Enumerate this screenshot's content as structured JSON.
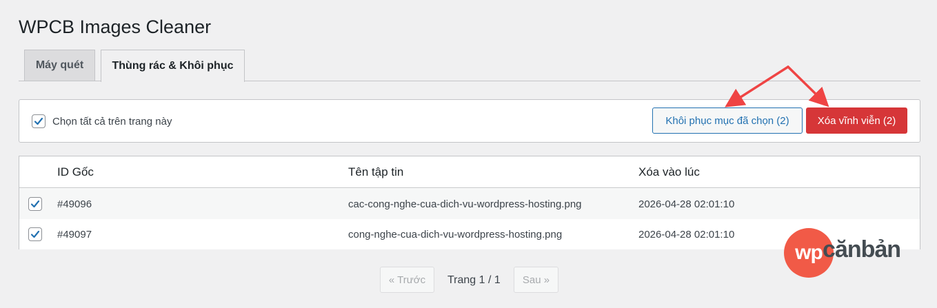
{
  "page": {
    "title": "WPCB Images Cleaner"
  },
  "tabs": [
    {
      "label": "Máy quét",
      "active": false
    },
    {
      "label": "Thùng rác & Khôi phục",
      "active": true
    }
  ],
  "toolbar": {
    "select_all_label": "Chọn tất cả trên trang này",
    "select_all_checked": true,
    "restore_label": "Khôi phục mục đã chọn (2)",
    "delete_label": "Xóa vĩnh viễn (2)"
  },
  "table": {
    "headers": [
      "ID Gốc",
      "Tên tập tin",
      "Xóa vào lúc"
    ],
    "rows": [
      {
        "checked": true,
        "id": "#49096",
        "filename": "cac-cong-nghe-cua-dich-vu-wordpress-hosting.png",
        "deleted_at": "2026-04-28 02:01:10"
      },
      {
        "checked": true,
        "id": "#49097",
        "filename": "cong-nghe-cua-dich-vu-wordpress-hosting.png",
        "deleted_at": "2026-04-28 02:01:10"
      }
    ]
  },
  "pagination": {
    "prev_label": "« Trước",
    "page_info": "Trang 1 / 1",
    "next_label": "Sau »"
  },
  "logo": {
    "badge": "wp",
    "text": "cănbản"
  },
  "colors": {
    "accent": "#2271b1",
    "danger": "#d63638",
    "arrow": "#ef4444",
    "logo_red": "#f15a47"
  },
  "icons": {
    "checkbox_check": "check-icon"
  }
}
